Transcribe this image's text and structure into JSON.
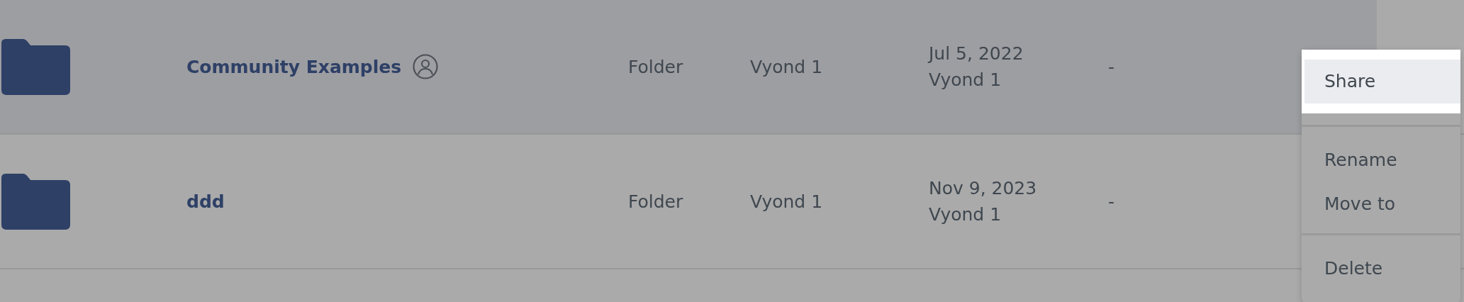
{
  "rows": [
    {
      "name": "Community Examples",
      "shared": true,
      "type": "Folder",
      "owner": "Vyond 1",
      "modified_date": "Jul 5, 2022",
      "modified_by": "Vyond 1",
      "size": "-",
      "selected": true
    },
    {
      "name": "ddd",
      "shared": false,
      "type": "Folder",
      "owner": "Vyond 1",
      "modified_date": "Nov 9, 2023",
      "modified_by": "Vyond 1",
      "size": "-",
      "selected": false
    }
  ],
  "context_menu": {
    "groups": [
      [
        {
          "label": "Share",
          "selected": true
        }
      ],
      [
        {
          "label": "Rename",
          "selected": false
        },
        {
          "label": "Move to",
          "selected": false
        }
      ],
      [
        {
          "label": "Delete",
          "selected": false
        }
      ]
    ]
  }
}
